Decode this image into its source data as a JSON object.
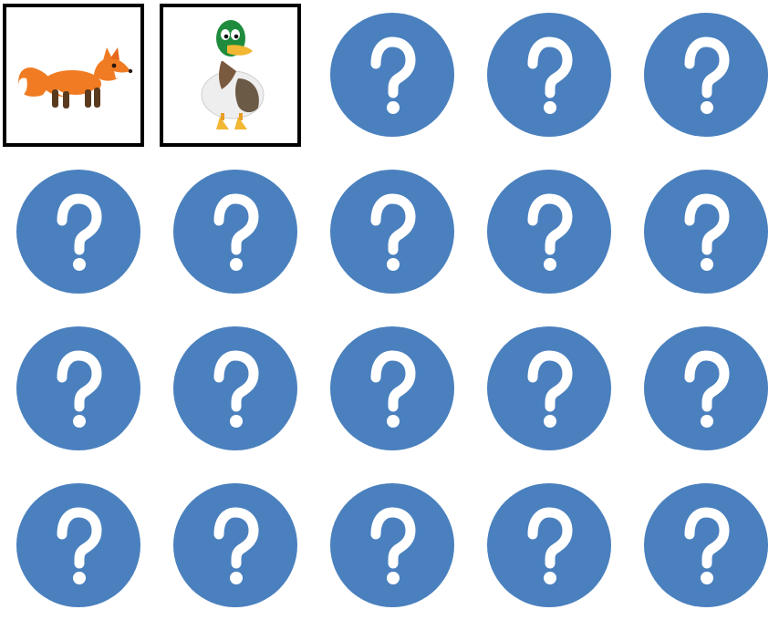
{
  "game": {
    "rows": 4,
    "columns": 5,
    "colors": {
      "card_back": "#4a80be",
      "question_mark": "#ffffff",
      "face_border": "#000000",
      "background": "#ffffff"
    },
    "cards": [
      {
        "state": "revealed",
        "content": "fox"
      },
      {
        "state": "revealed",
        "content": "duck"
      },
      {
        "state": "hidden"
      },
      {
        "state": "hidden"
      },
      {
        "state": "hidden"
      },
      {
        "state": "hidden"
      },
      {
        "state": "hidden"
      },
      {
        "state": "hidden"
      },
      {
        "state": "hidden"
      },
      {
        "state": "hidden"
      },
      {
        "state": "hidden"
      },
      {
        "state": "hidden"
      },
      {
        "state": "hidden"
      },
      {
        "state": "hidden"
      },
      {
        "state": "hidden"
      },
      {
        "state": "hidden"
      },
      {
        "state": "hidden"
      },
      {
        "state": "hidden"
      },
      {
        "state": "hidden"
      },
      {
        "state": "hidden"
      }
    ]
  }
}
